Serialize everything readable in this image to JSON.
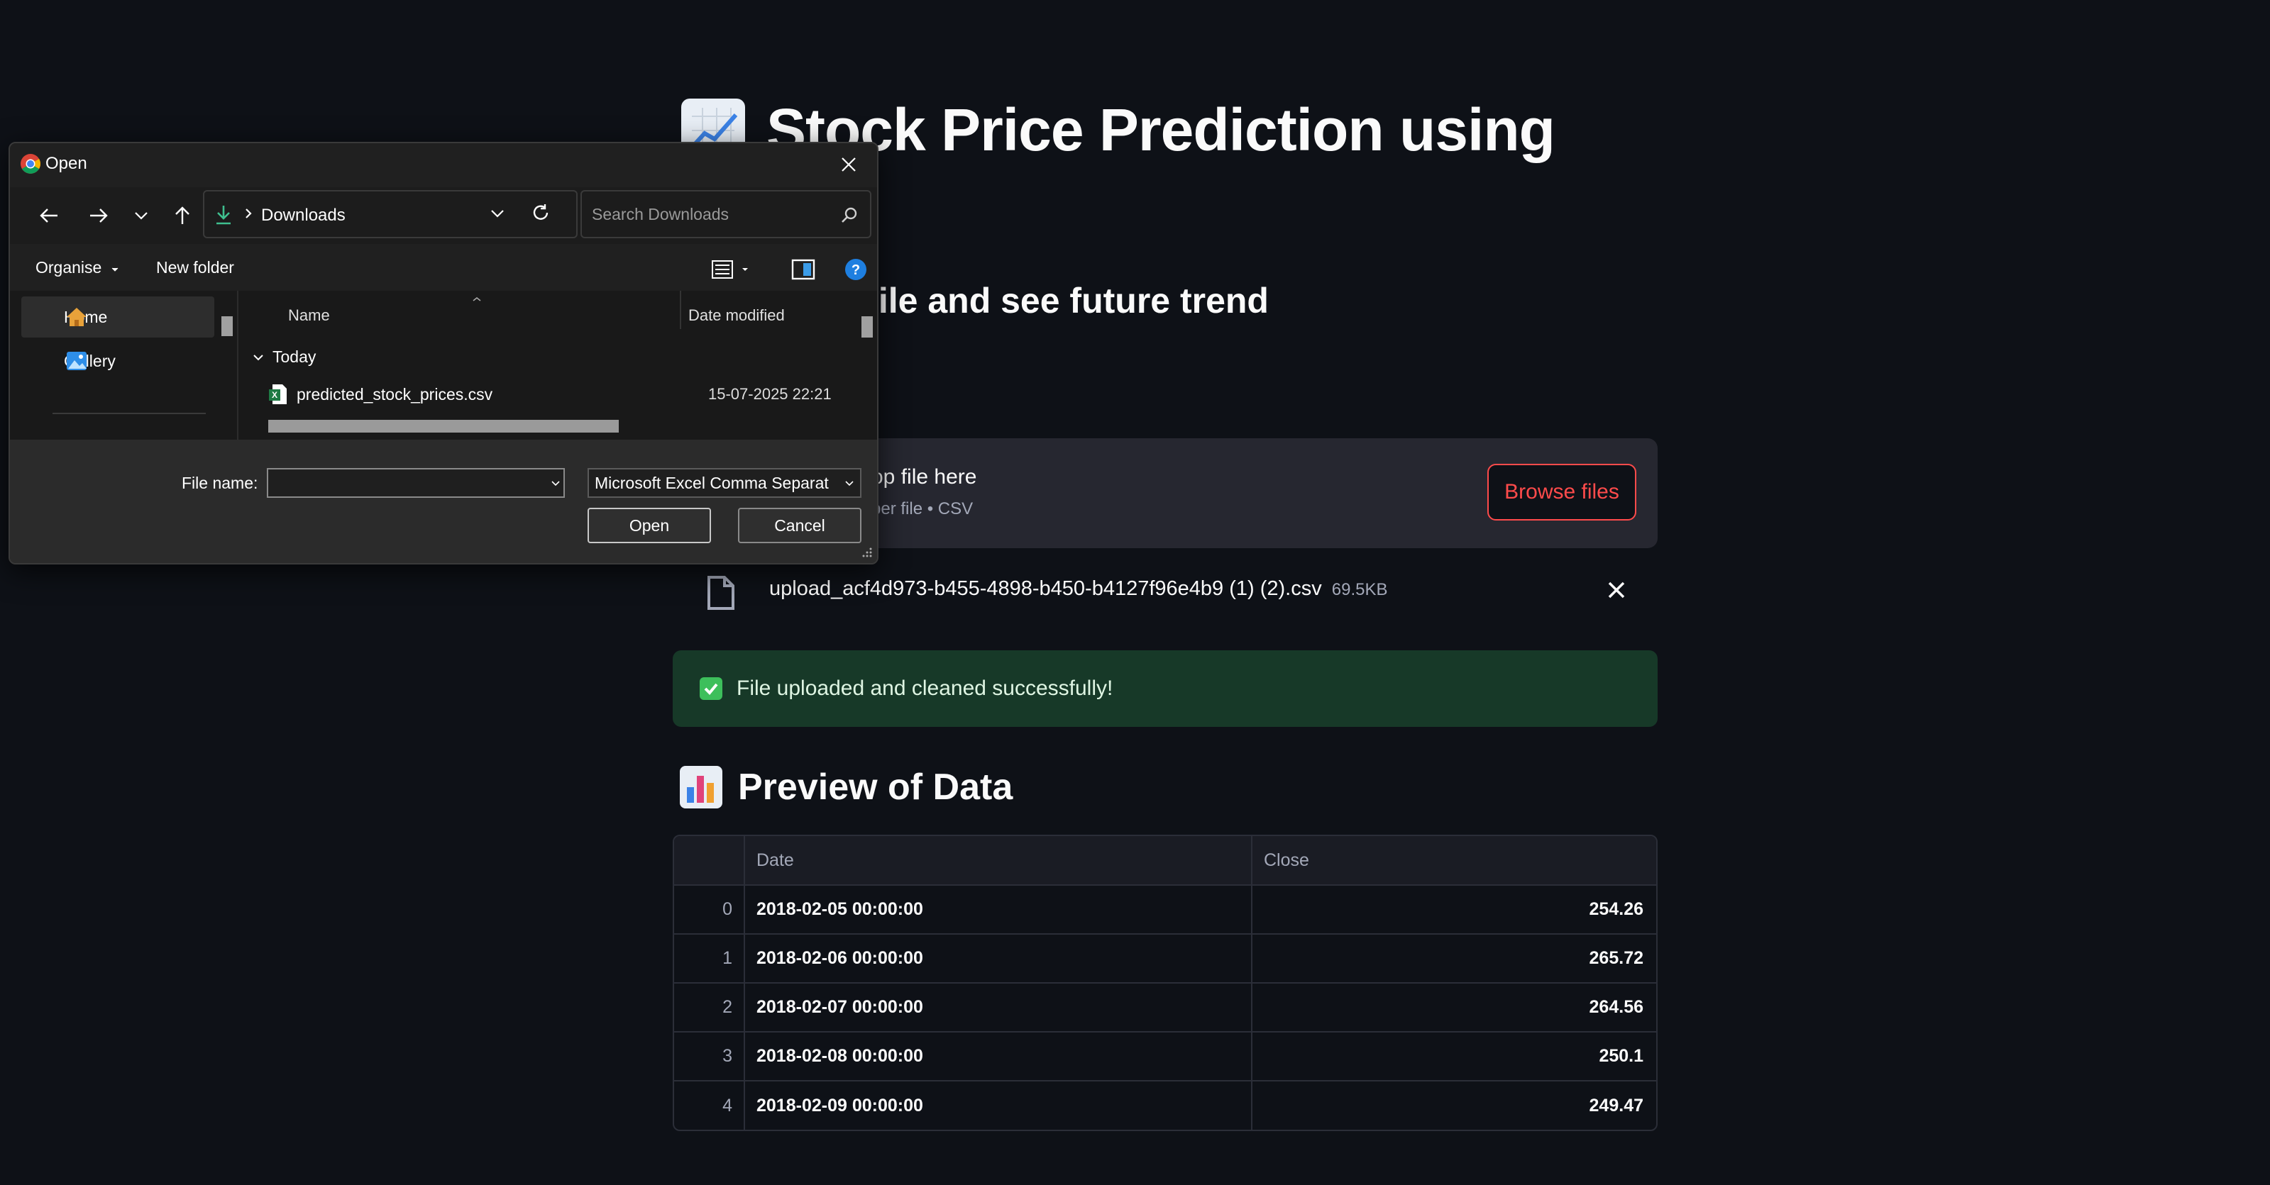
{
  "page": {
    "title": "Stock Price Prediction using",
    "subtitle": "stock CSV file and see future trend"
  },
  "uploader": {
    "main_text": "op file here",
    "sub_text": "per file • CSV",
    "browse_label": "Browse files"
  },
  "uploaded_file": {
    "name": "upload_acf4d973-b455-4898-b450-b4127f96e4b9 (1) (2).csv",
    "size": "69.5KB"
  },
  "success_message": "File uploaded and cleaned successfully!",
  "preview": {
    "title": "Preview of Data",
    "columns": [
      "",
      "Date",
      "Close"
    ],
    "rows": [
      {
        "index": "0",
        "date": "2018-02-05 00:00:00",
        "close": "254.26"
      },
      {
        "index": "1",
        "date": "2018-02-06 00:00:00",
        "close": "265.72"
      },
      {
        "index": "2",
        "date": "2018-02-07 00:00:00",
        "close": "264.56"
      },
      {
        "index": "3",
        "date": "2018-02-08 00:00:00",
        "close": "250.1"
      },
      {
        "index": "4",
        "date": "2018-02-09 00:00:00",
        "close": "249.47"
      }
    ]
  },
  "dialog": {
    "title": "Open",
    "address": "Downloads",
    "search_placeholder": "Search Downloads",
    "toolbar": {
      "organise": "Organise",
      "new_folder": "New folder"
    },
    "nav_items": [
      {
        "label": "Home"
      },
      {
        "label": "Gallery"
      }
    ],
    "columns": {
      "name": "Name",
      "date_modified": "Date modified"
    },
    "group": "Today",
    "files": [
      {
        "name": "predicted_stock_prices.csv",
        "date": "15-07-2025 22:21"
      }
    ],
    "file_name_label": "File name:",
    "file_name_value": "",
    "file_type": "Microsoft Excel Comma Separat",
    "open_label": "Open",
    "cancel_label": "Cancel"
  },
  "colors": {
    "background": "#0e1117",
    "accent": "#ff4b4b",
    "success_bg": "#173928"
  }
}
